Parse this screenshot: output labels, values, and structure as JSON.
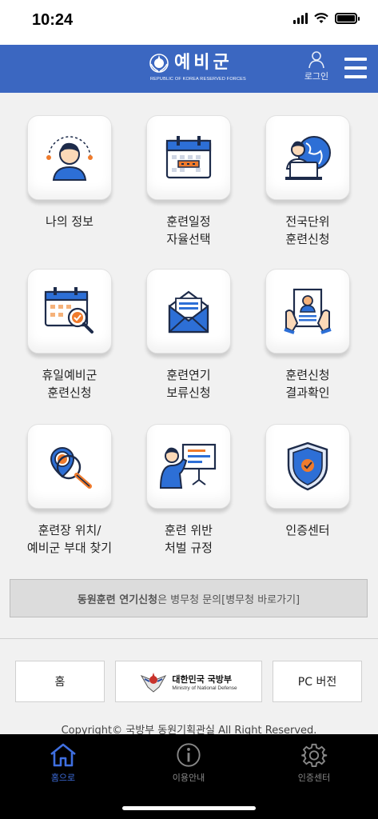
{
  "status": {
    "time": "10:24"
  },
  "header": {
    "logo_text": "예비군",
    "logo_sub": "REPUBLIC OF KOREA RESERVED FORCES",
    "login_label": "로그인",
    "brand_color": "#3b67c1"
  },
  "menu": [
    {
      "label": "나의 정보",
      "icon": "user-profile-icon"
    },
    {
      "label": "훈련일정\n자율선택",
      "icon": "calendar-icon"
    },
    {
      "label": "전국단위\n훈련신청",
      "icon": "globe-person-icon"
    },
    {
      "label": "휴일예비군\n훈련신청",
      "icon": "calendar-check-icon"
    },
    {
      "label": "훈련연기\n보류신청",
      "icon": "envelope-icon"
    },
    {
      "label": "훈련신청\n결과확인",
      "icon": "document-result-icon"
    },
    {
      "label": "훈련장 위치/\n예비군 부대 찾기",
      "icon": "location-search-icon"
    },
    {
      "label": "훈련 위반\n처벌 규정",
      "icon": "presentation-icon"
    },
    {
      "label": "인증센터",
      "icon": "shield-check-icon"
    }
  ],
  "notice": {
    "bold": "동원훈련 연기신청",
    "rest": "은 병무청 문의[병무청 바로가기]"
  },
  "footer": {
    "home_label": "홈",
    "mnd_title": "대한민국 국방부",
    "mnd_sub": "Ministry of National Defense",
    "pc_label": "PC 버전",
    "copyright": "Copyright© 국방부 동원기획관실 All Right Reserved."
  },
  "tabs": [
    {
      "label": "홈으로",
      "icon": "home-icon",
      "active": true
    },
    {
      "label": "이용안내",
      "icon": "info-icon",
      "active": false
    },
    {
      "label": "인증센터",
      "icon": "gear-icon",
      "active": false
    }
  ]
}
